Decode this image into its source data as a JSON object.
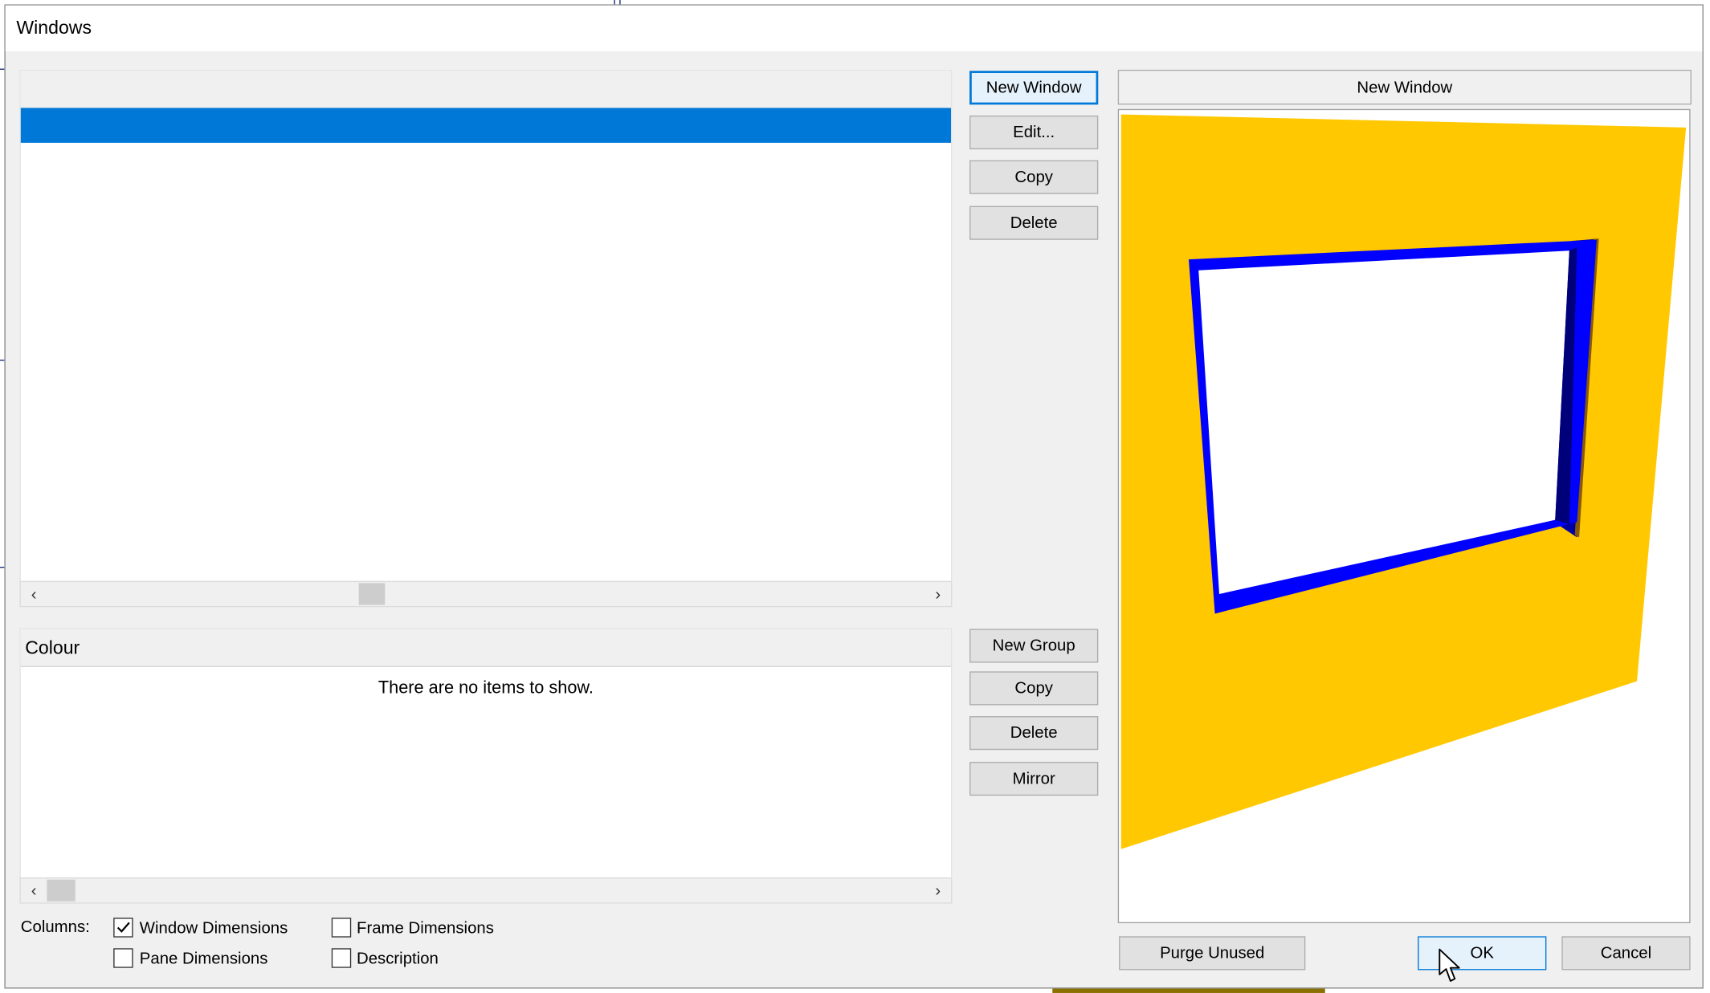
{
  "window": {
    "title": "Windows"
  },
  "top_buttons": {
    "new_window": "New Window",
    "edit": "Edit...",
    "copy": "Copy",
    "delete": "Delete"
  },
  "group_buttons": {
    "new_group": "New Group",
    "copy": "Copy",
    "delete": "Delete",
    "mirror": "Mirror"
  },
  "window_list": {
    "selected_row_text": ""
  },
  "colour_list": {
    "header": "Colour",
    "empty_message": "There are no items to show."
  },
  "columns": {
    "label": "Columns:",
    "options": [
      {
        "label": "Window Dimensions",
        "checked": true
      },
      {
        "label": "Frame Dimensions",
        "checked": false
      },
      {
        "label": "Pane Dimensions",
        "checked": false
      },
      {
        "label": "Description",
        "checked": false
      }
    ]
  },
  "preview": {
    "title": "New Window",
    "wall_color": "#ffc800",
    "frame_color": "#0000ff"
  },
  "footer": {
    "purge_unused": "Purge Unused",
    "ok": "OK",
    "cancel": "Cancel"
  },
  "icons": {
    "scroll_left": "chevron-left-icon",
    "scroll_right": "chevron-right-icon",
    "checkmark": "checkmark-icon",
    "cursor": "mouse-pointer-icon"
  }
}
